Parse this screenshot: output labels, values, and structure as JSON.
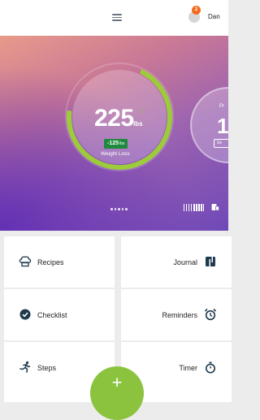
{
  "header": {
    "menu_icon": "hamburger-icon",
    "notification_count": "2",
    "username": "Dan"
  },
  "hero": {
    "weight_value": "225",
    "weight_unit": "lbs",
    "trend_icon": "down-arrow-icon",
    "loss_value": "-125",
    "loss_unit": "lbs",
    "loss_label": "Weight Loss",
    "progress_fraction": 0.7,
    "next_card_title": "Pr",
    "next_card_number": "1",
    "next_card_button": "Se",
    "page_dots": 5,
    "colors": {
      "ring": "#9ccc3a",
      "loss_pill": "#1f8a3d"
    }
  },
  "tiles": [
    {
      "label": "Recipes",
      "icon": "chef-hat-icon"
    },
    {
      "label": "Journal",
      "icon": "journal-icon"
    },
    {
      "label": "Checklist",
      "icon": "check-circle-icon"
    },
    {
      "label": "Reminders",
      "icon": "alarm-clock-icon"
    },
    {
      "label": "Steps",
      "icon": "runner-icon"
    },
    {
      "label": "Timer",
      "icon": "stopwatch-icon"
    }
  ],
  "fab": {
    "label": "+",
    "color": "#8bc33f"
  }
}
